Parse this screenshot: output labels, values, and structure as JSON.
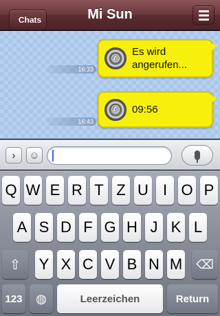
{
  "header": {
    "back_label": "Chats",
    "title": "Mi Sun",
    "menu_icon": "hamburger-icon"
  },
  "messages": [
    {
      "icon": "call-icon",
      "text": "Es wird angerufen...",
      "time": "16:33"
    },
    {
      "icon": "call-icon",
      "text": "09:56",
      "time": "16:43"
    }
  ],
  "input_bar": {
    "expand_icon": "chevron-right-icon",
    "emoji_icon": "smiley-icon",
    "text_value": "",
    "mic_icon": "microphone-icon"
  },
  "keyboard": {
    "row1": [
      "Q",
      "W",
      "E",
      "R",
      "T",
      "Z",
      "U",
      "I",
      "O",
      "P"
    ],
    "row2": [
      "A",
      "S",
      "D",
      "F",
      "G",
      "H",
      "J",
      "K",
      "L"
    ],
    "row3": [
      "Y",
      "X",
      "C",
      "V",
      "B",
      "N",
      "M"
    ],
    "shift_icon": "shift-arrow-icon",
    "delete_icon": "backspace-icon",
    "numbers_label": "123",
    "globe_icon": "globe-icon",
    "space_label": "Leerzeichen",
    "return_label": "Return"
  },
  "colors": {
    "navbar": "#6c3a3f",
    "chat_background": "#a9c6ec",
    "bubble": "#f7f00c"
  }
}
